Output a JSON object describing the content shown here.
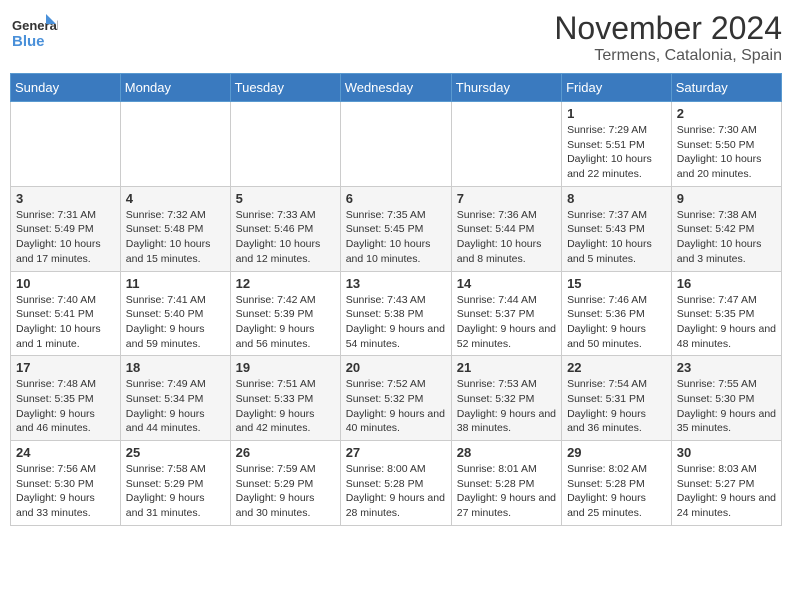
{
  "logo": {
    "line1": "General",
    "line2": "Blue"
  },
  "title": "November 2024",
  "location": "Termens, Catalonia, Spain",
  "days_of_week": [
    "Sunday",
    "Monday",
    "Tuesday",
    "Wednesday",
    "Thursday",
    "Friday",
    "Saturday"
  ],
  "weeks": [
    [
      {
        "day": "",
        "info": ""
      },
      {
        "day": "",
        "info": ""
      },
      {
        "day": "",
        "info": ""
      },
      {
        "day": "",
        "info": ""
      },
      {
        "day": "",
        "info": ""
      },
      {
        "day": "1",
        "info": "Sunrise: 7:29 AM\nSunset: 5:51 PM\nDaylight: 10 hours and 22 minutes."
      },
      {
        "day": "2",
        "info": "Sunrise: 7:30 AM\nSunset: 5:50 PM\nDaylight: 10 hours and 20 minutes."
      }
    ],
    [
      {
        "day": "3",
        "info": "Sunrise: 7:31 AM\nSunset: 5:49 PM\nDaylight: 10 hours and 17 minutes."
      },
      {
        "day": "4",
        "info": "Sunrise: 7:32 AM\nSunset: 5:48 PM\nDaylight: 10 hours and 15 minutes."
      },
      {
        "day": "5",
        "info": "Sunrise: 7:33 AM\nSunset: 5:46 PM\nDaylight: 10 hours and 12 minutes."
      },
      {
        "day": "6",
        "info": "Sunrise: 7:35 AM\nSunset: 5:45 PM\nDaylight: 10 hours and 10 minutes."
      },
      {
        "day": "7",
        "info": "Sunrise: 7:36 AM\nSunset: 5:44 PM\nDaylight: 10 hours and 8 minutes."
      },
      {
        "day": "8",
        "info": "Sunrise: 7:37 AM\nSunset: 5:43 PM\nDaylight: 10 hours and 5 minutes."
      },
      {
        "day": "9",
        "info": "Sunrise: 7:38 AM\nSunset: 5:42 PM\nDaylight: 10 hours and 3 minutes."
      }
    ],
    [
      {
        "day": "10",
        "info": "Sunrise: 7:40 AM\nSunset: 5:41 PM\nDaylight: 10 hours and 1 minute."
      },
      {
        "day": "11",
        "info": "Sunrise: 7:41 AM\nSunset: 5:40 PM\nDaylight: 9 hours and 59 minutes."
      },
      {
        "day": "12",
        "info": "Sunrise: 7:42 AM\nSunset: 5:39 PM\nDaylight: 9 hours and 56 minutes."
      },
      {
        "day": "13",
        "info": "Sunrise: 7:43 AM\nSunset: 5:38 PM\nDaylight: 9 hours and 54 minutes."
      },
      {
        "day": "14",
        "info": "Sunrise: 7:44 AM\nSunset: 5:37 PM\nDaylight: 9 hours and 52 minutes."
      },
      {
        "day": "15",
        "info": "Sunrise: 7:46 AM\nSunset: 5:36 PM\nDaylight: 9 hours and 50 minutes."
      },
      {
        "day": "16",
        "info": "Sunrise: 7:47 AM\nSunset: 5:35 PM\nDaylight: 9 hours and 48 minutes."
      }
    ],
    [
      {
        "day": "17",
        "info": "Sunrise: 7:48 AM\nSunset: 5:35 PM\nDaylight: 9 hours and 46 minutes."
      },
      {
        "day": "18",
        "info": "Sunrise: 7:49 AM\nSunset: 5:34 PM\nDaylight: 9 hours and 44 minutes."
      },
      {
        "day": "19",
        "info": "Sunrise: 7:51 AM\nSunset: 5:33 PM\nDaylight: 9 hours and 42 minutes."
      },
      {
        "day": "20",
        "info": "Sunrise: 7:52 AM\nSunset: 5:32 PM\nDaylight: 9 hours and 40 minutes."
      },
      {
        "day": "21",
        "info": "Sunrise: 7:53 AM\nSunset: 5:32 PM\nDaylight: 9 hours and 38 minutes."
      },
      {
        "day": "22",
        "info": "Sunrise: 7:54 AM\nSunset: 5:31 PM\nDaylight: 9 hours and 36 minutes."
      },
      {
        "day": "23",
        "info": "Sunrise: 7:55 AM\nSunset: 5:30 PM\nDaylight: 9 hours and 35 minutes."
      }
    ],
    [
      {
        "day": "24",
        "info": "Sunrise: 7:56 AM\nSunset: 5:30 PM\nDaylight: 9 hours and 33 minutes."
      },
      {
        "day": "25",
        "info": "Sunrise: 7:58 AM\nSunset: 5:29 PM\nDaylight: 9 hours and 31 minutes."
      },
      {
        "day": "26",
        "info": "Sunrise: 7:59 AM\nSunset: 5:29 PM\nDaylight: 9 hours and 30 minutes."
      },
      {
        "day": "27",
        "info": "Sunrise: 8:00 AM\nSunset: 5:28 PM\nDaylight: 9 hours and 28 minutes."
      },
      {
        "day": "28",
        "info": "Sunrise: 8:01 AM\nSunset: 5:28 PM\nDaylight: 9 hours and 27 minutes."
      },
      {
        "day": "29",
        "info": "Sunrise: 8:02 AM\nSunset: 5:28 PM\nDaylight: 9 hours and 25 minutes."
      },
      {
        "day": "30",
        "info": "Sunrise: 8:03 AM\nSunset: 5:27 PM\nDaylight: 9 hours and 24 minutes."
      }
    ]
  ]
}
